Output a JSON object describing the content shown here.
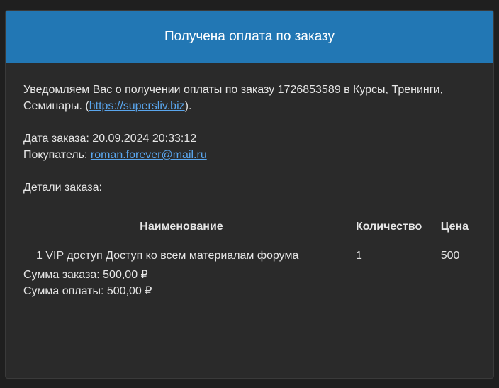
{
  "header": {
    "title": "Получена оплата по заказу"
  },
  "intro": {
    "text_before": "Уведомляем Вас о получении оплаты по заказу 1726853589 в Курсы, Тренинги, Семинары. (",
    "link": "https://supersliv.biz",
    "text_after": ")."
  },
  "meta": {
    "date_label": "Дата заказа: 20.09.2024 20:33:12",
    "buyer_label": "Покупатель: ",
    "buyer_email": "roman.forever@mail.ru"
  },
  "details": {
    "title": "Детали заказа:",
    "columns": {
      "name": "Наименование",
      "qty": "Количество",
      "price": "Цена"
    },
    "rows": [
      {
        "name": "1 VIP доступ Доступ ко всем материалам форума",
        "qty": "1",
        "price": "500"
      }
    ]
  },
  "totals": {
    "order_sum": "Сумма заказа: 500,00 ₽",
    "paid_sum": "Сумма оплаты: 500,00 ₽"
  },
  "colors": {
    "header_bg": "#2277b4",
    "card_bg": "#2a2a2a",
    "link": "#5aa6ee"
  }
}
